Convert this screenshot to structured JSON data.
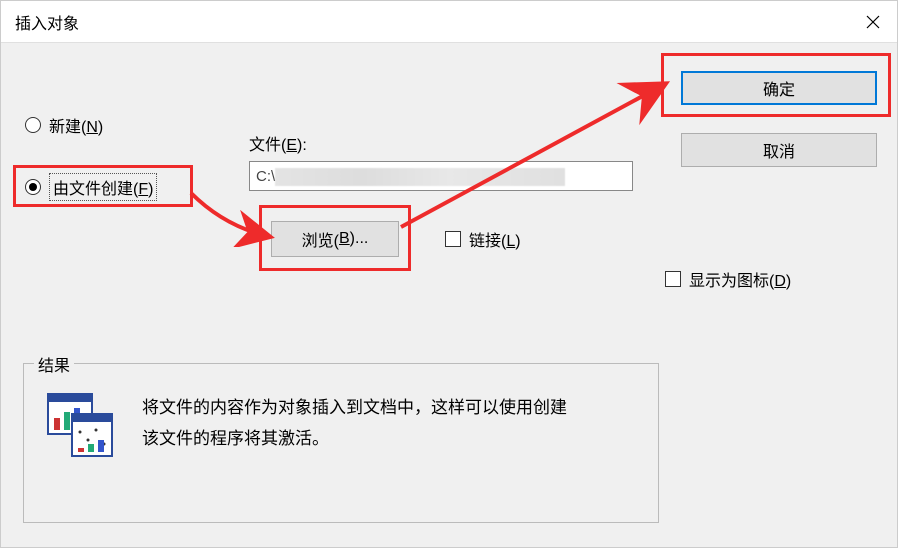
{
  "window": {
    "title": "插入对象"
  },
  "radios": {
    "create_new": "新建(N)",
    "from_file": "由文件创建(F)"
  },
  "file": {
    "label": "文件(E):",
    "value_prefix": "C:\\"
  },
  "buttons": {
    "browse": "浏览(B)...",
    "ok": "确定",
    "cancel": "取消"
  },
  "checkboxes": {
    "link": "链接(L)",
    "show_as_icon": "显示为图标(D)"
  },
  "result": {
    "title": "结果",
    "text": "将文件的内容作为对象插入到文档中，这样可以使用创建该文件的程序将其激活。"
  }
}
